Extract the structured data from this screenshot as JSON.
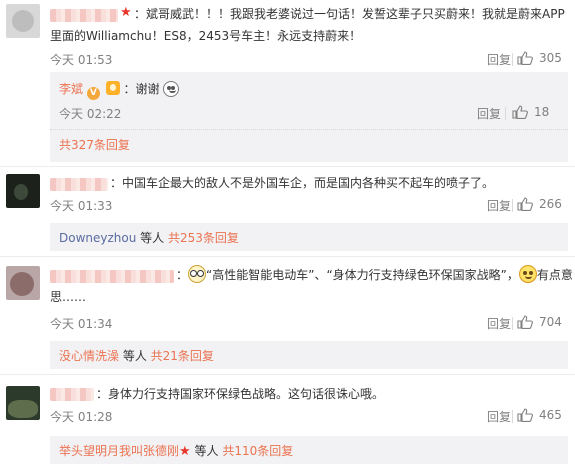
{
  "comments": [
    {
      "text_line1": "：斌哥威武！！！我跟我老婆说过一句话！发誓这辈子只买蔚来！我就是蔚来APP",
      "text_line2": "里面的Williamchu！ES8，2453号车主！永远支持蔚来！",
      "time": "今天 01:53",
      "reply_label": "回复",
      "likes": "305",
      "sub_reply": {
        "author": "李斌",
        "text": "：谢谢",
        "time": "今天 02:22",
        "reply_label": "回复",
        "likes": "18"
      },
      "more_link": "共327条回复"
    },
    {
      "text_line1": "：中国车企最大的敌人不是外国车企，而是国内各种买不起车的喷子了。",
      "time": "今天 01:33",
      "reply_label": "回复",
      "likes": "266",
      "more": {
        "name": "Downeyzhou",
        "suffix": " 等人 ",
        "link": "共253条回复"
      }
    },
    {
      "text_line1a": "：",
      "text_line1b": "“高性能智能电动车”、“身体力行支持绿色环保国家战略”，",
      "text_line1c": "有点意",
      "text_line2": "思……",
      "time": "今天 01:34",
      "reply_label": "回复",
      "likes": "704",
      "more": {
        "name": "没心情洗澡",
        "suffix": " 等人 ",
        "link": "共21条回复"
      }
    },
    {
      "text_line1": "：身体力行支持国家环保绿色战略。这句话很诛心哦。",
      "time": "今天 01:28",
      "reply_label": "回复",
      "likes": "465",
      "more": {
        "name": "举头望明月我叫张德刚",
        "suffix": " 等人 ",
        "link": "共110条回复"
      }
    }
  ],
  "colors": {
    "accent": "#eb7350",
    "muted": "#808080",
    "text": "#333333",
    "subbox": "#f2f2f5"
  },
  "icons": {
    "like": "thumbs-up-icon",
    "vip": "vip-badge-icon",
    "star": "red-star-icon"
  }
}
